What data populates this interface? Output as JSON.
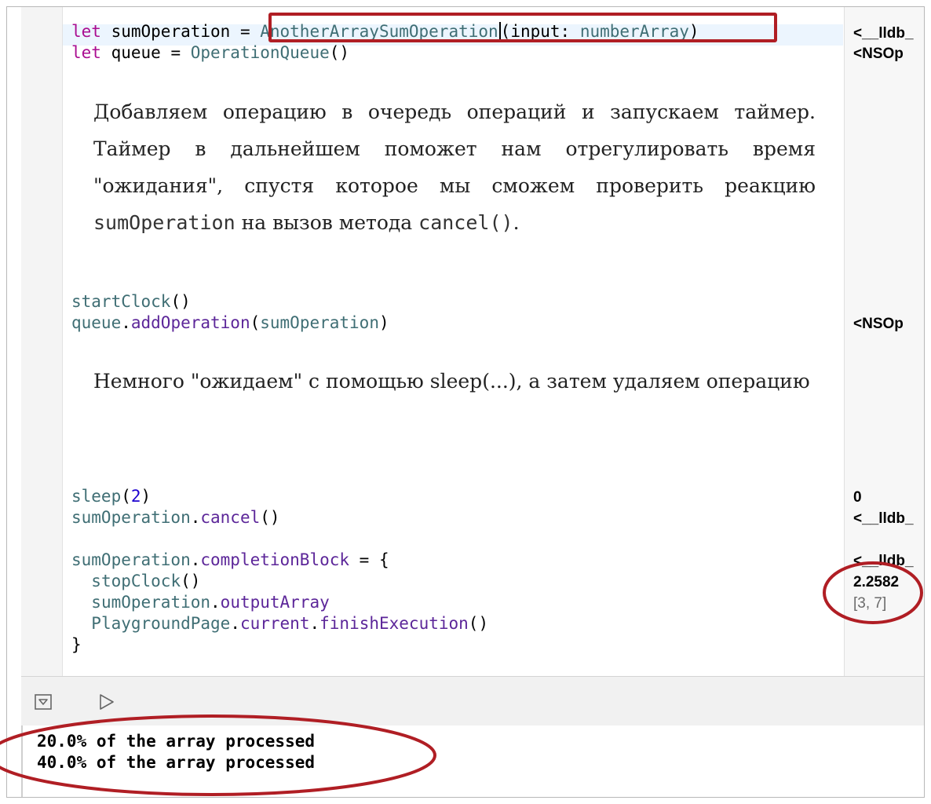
{
  "editor": {
    "line1": {
      "kw": "let",
      "name": " sumOperation = ",
      "type": "AnotherArraySumOperation",
      "args_open": "(input: ",
      "arg_val": "numberArray",
      "args_close": ")"
    },
    "line2": {
      "kw": "let",
      "name": " queue = ",
      "type": "OperationQueue",
      "parens": "()"
    },
    "prose1": {
      "text_a": "Добавляем операцию в очередь операций и запускаем таймер. Таймер в дальнейшем поможет нам отрегулировать время \"ожидания\", спустя которое мы сможем проверить реакцию ",
      "code_a": "sumOperation",
      "text_b": " на вызов метода ",
      "code_b": "cancel()",
      "text_c": "."
    },
    "line3": {
      "fn": "startClock",
      "parens": "()"
    },
    "line4": {
      "obj": "queue",
      "dot": ".",
      "method": "addOperation",
      "open": "(",
      "arg": "sumOperation",
      "close": ")"
    },
    "prose2": {
      "text": "Немного \"ожидаем\" с помощью sleep(...), а затем удаляем операцию"
    },
    "line5": {
      "fn": "sleep",
      "open": "(",
      "num": "2",
      "close": ")"
    },
    "line6": {
      "obj": "sumOperation",
      "dot": ".",
      "method": "cancel",
      "parens": "()"
    },
    "line7": {
      "obj": "sumOperation",
      "dot": ".",
      "prop": "completionBlock",
      "rest": " = {"
    },
    "line8": {
      "indent": "  ",
      "fn": "stopClock",
      "parens": "()"
    },
    "line9": {
      "indent": "  ",
      "obj": "sumOperation",
      "dot": ".",
      "prop": "outputArray"
    },
    "line10": {
      "indent": "  ",
      "type": "PlaygroundPage",
      "dot1": ".",
      "prop": "current",
      "dot2": ".",
      "method": "finishExecution",
      "parens": "()"
    },
    "line11": {
      "text": "}"
    }
  },
  "results": {
    "r1": "<__lldb_",
    "r2": "<NSOp",
    "r4": "<NSOp",
    "r5": "0",
    "r6": "<__lldb_",
    "r7": "<__lldb_",
    "r8": "2.2582",
    "r9": "[3, 7]"
  },
  "console": {
    "lines": [
      "20.0% of the array processed",
      "40.0% of the array processed"
    ]
  },
  "icons": {
    "toggle": "hide-debug-area-icon",
    "run": "run-playground-icon"
  },
  "colors": {
    "keyword": "#aa0d91",
    "type": "#3f6e74",
    "method": "#5c2699",
    "number": "#1c00cf",
    "annotation": "#b01e24"
  }
}
